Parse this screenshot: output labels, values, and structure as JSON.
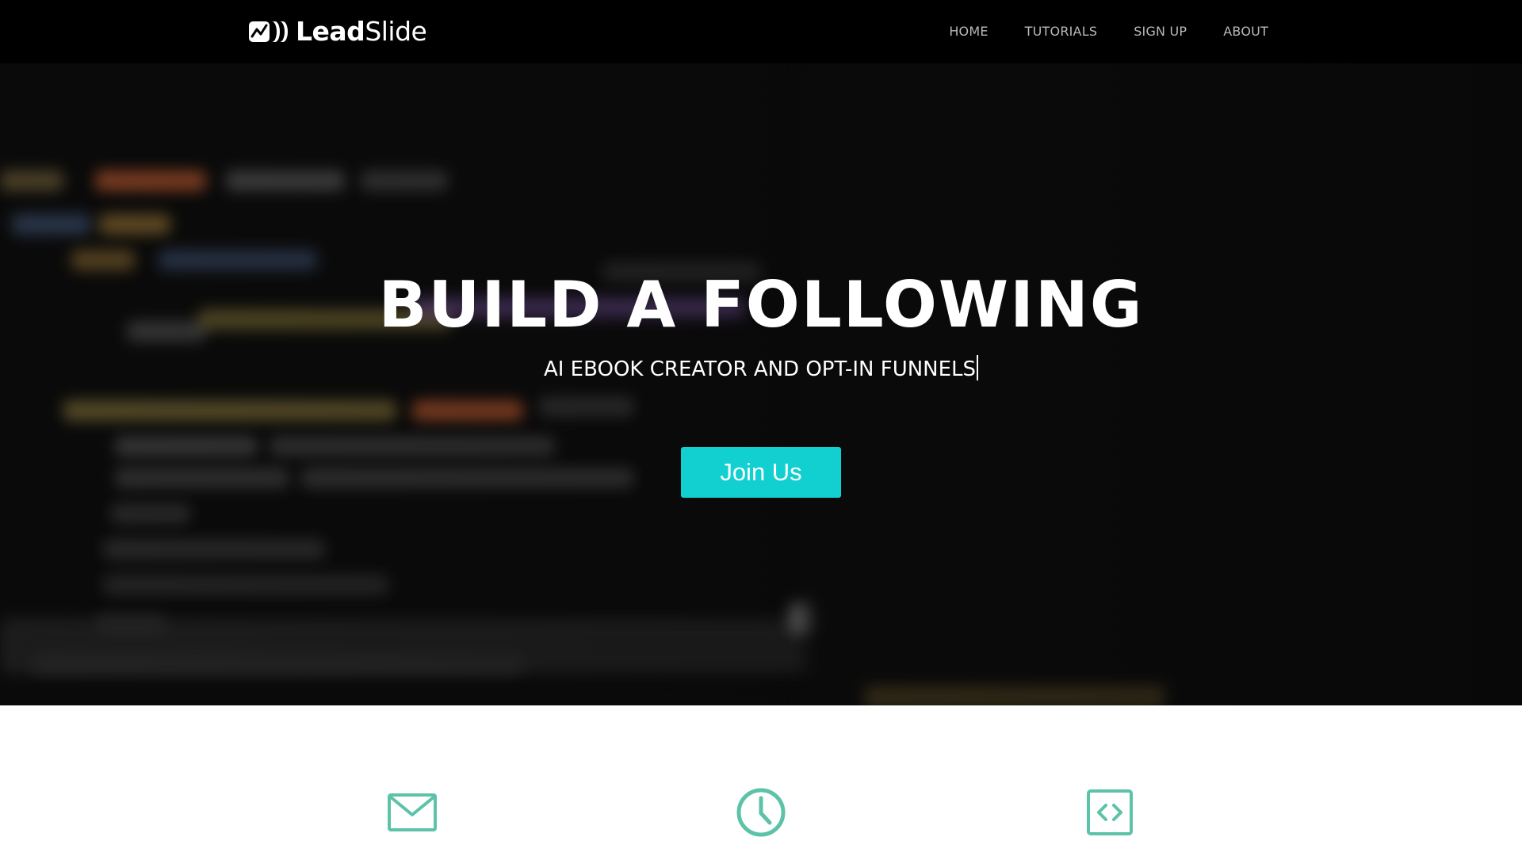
{
  "nav": {
    "brand": {
      "bold": "Lead",
      "light": "Slide"
    },
    "links": [
      "HOME",
      "TUTORIALS",
      "SIGN UP",
      "ABOUT"
    ]
  },
  "hero": {
    "title": "BUILD A FOLLOWING",
    "subtitle": "AI EBOOK CREATOR AND OPT-IN FUNNELS",
    "cta_label": "Join Us"
  },
  "features": {
    "icons": [
      "envelope-icon",
      "clock-icon",
      "code-icon"
    ]
  },
  "colors": {
    "accent": "#13d0d0",
    "icon": "#5cc2a8",
    "nav_bg": "#000000",
    "nav_link": "#b9b9b9"
  }
}
